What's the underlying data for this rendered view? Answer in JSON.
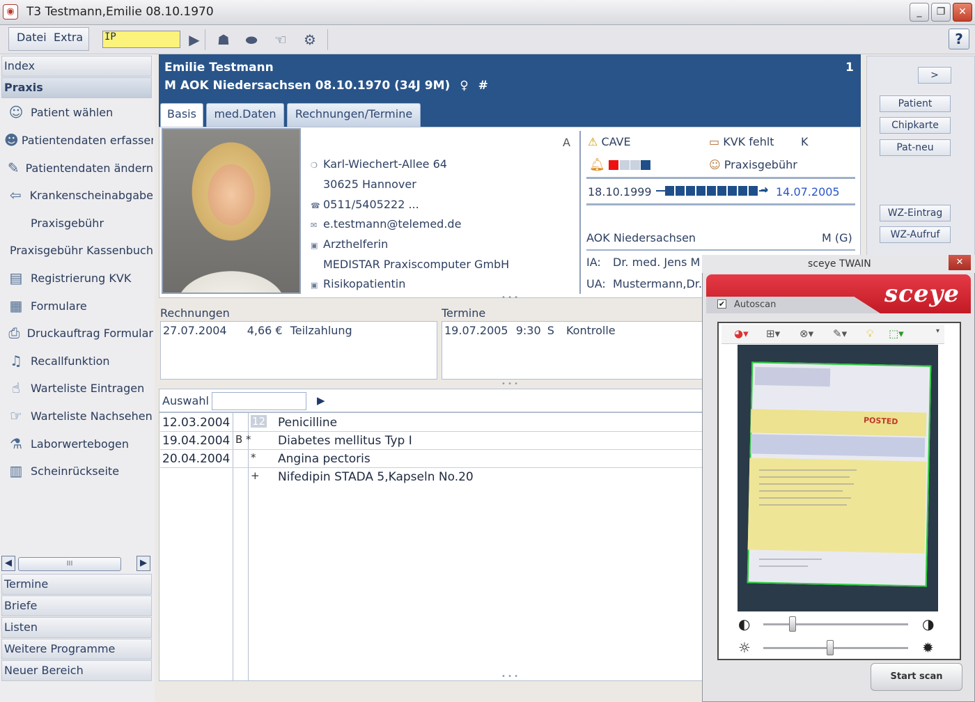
{
  "window": {
    "title": "T3 Testmann,Emilie  08.10.1970",
    "minimize": "_",
    "restore": "❐",
    "close": "✕"
  },
  "menu": {
    "datei": "Datei",
    "extra": "Extra",
    "ip_value": "IP",
    "help": "?"
  },
  "sidebar": {
    "index": "Index",
    "praxis": "Praxis",
    "items": [
      {
        "label": "Patient wählen",
        "icon": "patient-select-icon",
        "glyph": "☺"
      },
      {
        "label": "Patientendaten erfassen",
        "icon": "patient-record-icon",
        "glyph": "☻"
      },
      {
        "label": "Patientendaten ändern",
        "icon": "patient-edit-icon",
        "glyph": "✎"
      },
      {
        "label": "Krankenscheinabgabe",
        "icon": "arrow-left-icon",
        "glyph": "⇦"
      },
      {
        "label": "Praxisgebühr",
        "icon": "",
        "glyph": ""
      },
      {
        "label": "Praxisgebühr Kassenbuch",
        "icon": "",
        "glyph": ""
      },
      {
        "label": "Registrierung KVK",
        "icon": "card-reader-icon",
        "glyph": "▤"
      },
      {
        "label": "Formulare",
        "icon": "forms-icon",
        "glyph": "▦"
      },
      {
        "label": "Druckauftrag Formular",
        "icon": "printer-icon",
        "glyph": "⎙"
      },
      {
        "label": "Recallfunktion",
        "icon": "bell-icon",
        "glyph": "♫"
      },
      {
        "label": "Warteliste Eintragen",
        "icon": "waitlist-add-icon",
        "glyph": "☝"
      },
      {
        "label": "Warteliste Nachsehen",
        "icon": "waitlist-view-icon",
        "glyph": "☞"
      },
      {
        "label": "Laborwertebogen",
        "icon": "lab-icon",
        "glyph": "⚗"
      },
      {
        "label": "Scheinrückseite",
        "icon": "form-back-icon",
        "glyph": "▥"
      }
    ],
    "scroll_thumb": "III",
    "bottom": [
      "Termine",
      "Briefe",
      "Listen",
      "Weitere Programme",
      "Neuer Bereich"
    ]
  },
  "header": {
    "name": "Emilie Testmann",
    "info": "M AOK Niedersachsen 08.10.1970 (34J 9M)",
    "gender_symbol": "♀",
    "hash": "#",
    "number": "1"
  },
  "tabs": [
    "Basis",
    "med.Daten",
    "Rechnungen/Termine"
  ],
  "patient": {
    "street": "Karl-Wiechert-Allee 64",
    "city": "30625 Hannover",
    "phone": "0511/5405222 ...",
    "email": "e.testmann@telemed.de",
    "job": "Arzthelferin",
    "employer": "MEDISTAR Praxiscomputer GmbH",
    "risk": "Risikopatientin",
    "marker": "A"
  },
  "status": {
    "cave": "CAVE",
    "kvk": "KVK fehlt",
    "kvk_marker": "K",
    "praxisgebuehr": "Praxisgebühr",
    "date_from": "18.10.1999",
    "date_to": "14.07.2005",
    "insurance": "AOK Niedersachsen",
    "insurance_status": "M (G)",
    "ia_label": "IA:",
    "ia_value": "Dr. med. Jens M",
    "ua_label": "UA:",
    "ua_value": "Mustermann,Dr."
  },
  "rechnungen": {
    "title": "Rechnungen",
    "date": "27.07.2004",
    "amount": "4,66 €",
    "type": "Teilzahlung"
  },
  "termine": {
    "title": "Termine",
    "date": "19.07.2005",
    "time": "9:30",
    "marker": "S",
    "type": "Kontrolle"
  },
  "auswahl": {
    "label": "Auswahl",
    "value": ""
  },
  "diagnoses": [
    {
      "date": "12.03.2004",
      "mark": "12",
      "text": "Penicilline"
    },
    {
      "date": "19.04.2004",
      "mark": "B  *",
      "text": "Diabetes mellitus Typ I"
    },
    {
      "date": "20.04.2004",
      "mark": "*",
      "text": "Angina pectoris"
    },
    {
      "date": "",
      "mark": "+",
      "text": "Nifedipin STADA 5,Kapseln No.20"
    }
  ],
  "right_panel": {
    "nav": ">",
    "buttons": [
      "Patient",
      "Chipkarte",
      "Pat-neu"
    ],
    "wz_eintrag": "WZ-Eintrag",
    "wz_aufruf": "WZ-Aufruf"
  },
  "sceye": {
    "title": "sceye TWAIN",
    "close": "✕",
    "logo": "sceye",
    "autoscan": "Autoscan",
    "autoscan_checked": true,
    "contrast_level": 0.2,
    "brightness_level": 0.46,
    "start_scan": "Start scan",
    "doc_stamp": "POSTED"
  },
  "colors": {
    "header_blue": "#285489",
    "accent_red": "#d62a34",
    "ip_yellow": "#fbf37b",
    "crop_green": "#2ecc40"
  }
}
